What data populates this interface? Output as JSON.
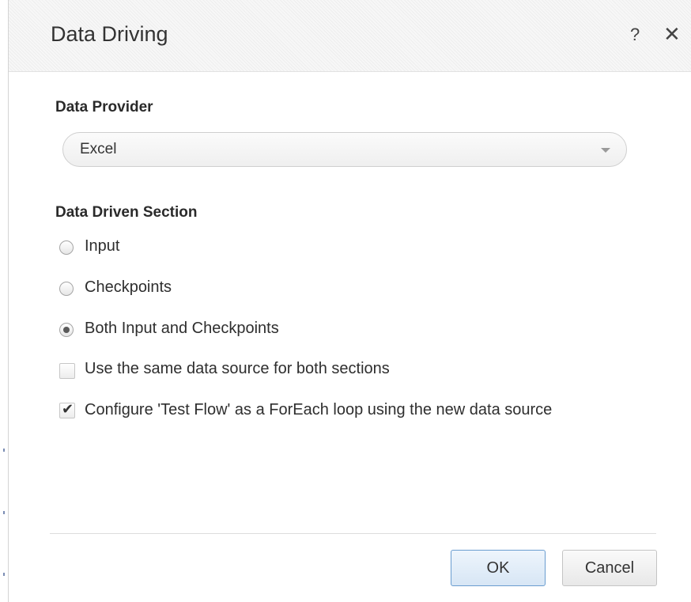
{
  "dialog": {
    "title": "Data Driving",
    "help_label": "?",
    "close_label": "✕"
  },
  "data_provider": {
    "label": "Data Provider",
    "selected": "Excel"
  },
  "data_driven_section": {
    "label": "Data Driven Section",
    "options": [
      {
        "label": "Input",
        "selected": false
      },
      {
        "label": "Checkpoints",
        "selected": false
      },
      {
        "label": "Both Input and Checkpoints",
        "selected": true
      }
    ]
  },
  "checkboxes": [
    {
      "label": "Use the same data source for both sections",
      "checked": false
    },
    {
      "label": "Configure 'Test Flow' as a ForEach loop using the new data source",
      "checked": true
    }
  ],
  "buttons": {
    "ok": "OK",
    "cancel": "Cancel"
  },
  "colors": {
    "ok_border": "#6a9dd0",
    "title_text": "#333333"
  }
}
